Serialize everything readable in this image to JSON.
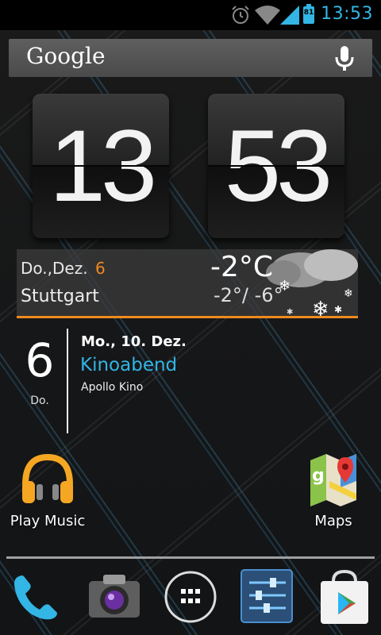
{
  "status_bar": {
    "time": "13:53",
    "battery_level": "81",
    "icons": [
      "alarm-icon",
      "wifi-icon",
      "signal-icon",
      "battery-icon"
    ],
    "accent_color": "#33b5e5"
  },
  "search": {
    "logo_text": "Google",
    "icons": [
      "mic-icon"
    ]
  },
  "clock": {
    "hours": "13",
    "minutes": "53"
  },
  "weather": {
    "date_label": "Do.,Dez.",
    "day_number": "6",
    "city": "Stuttgart",
    "current_temp": "-2°C",
    "temp_range": "-2°/ -6°",
    "accent_color": "#f08a1d",
    "icons": [
      "snow-cloud-icon"
    ]
  },
  "calendar": {
    "day_number": "6",
    "weekday": "Do.",
    "event_date": "Mo., 10. Dez.",
    "event_title": "Kinoabend",
    "event_location": "Apollo Kino"
  },
  "apps": [
    {
      "label": "Play Music",
      "icon": "headphones-icon"
    },
    {
      "label": "Maps",
      "icon": "maps-icon"
    }
  ],
  "dock": {
    "icons": [
      "phone-icon",
      "camera-icon",
      "app-drawer-icon",
      "settings-icon",
      "play-store-icon"
    ]
  }
}
